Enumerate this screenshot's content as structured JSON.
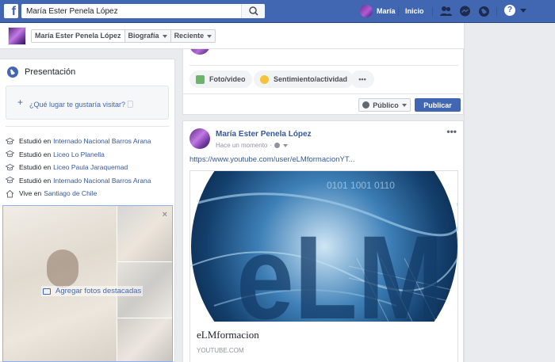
{
  "topbar": {
    "logo": "f",
    "search_value": "María Ester Penela López",
    "user_name": "María",
    "home_label": "Inicio",
    "help_label": "?"
  },
  "timeline_header": {
    "tabs": [
      {
        "label": "María Ester Penela López"
      },
      {
        "label": "Biografía"
      },
      {
        "label": "Reciente"
      }
    ]
  },
  "intro": {
    "title": "Presentación",
    "visit_prompt": "¿Qué lugar te gustaría visitar? 🗌",
    "items": [
      {
        "prefix": "Estudió en",
        "link": "Internado Nacional Barros Arana",
        "icon": "graduation-cap-icon"
      },
      {
        "prefix": "Estudió en",
        "link": "Liceo Lo Planella",
        "icon": "graduation-cap-icon"
      },
      {
        "prefix": "Estudió en",
        "link": "Liceo Paula Jaraquemad",
        "icon": "graduation-cap-icon"
      },
      {
        "prefix": "Estudió en",
        "link": "Internado Nacional Barros Arana",
        "icon": "graduation-cap-icon"
      },
      {
        "prefix": "Vive en",
        "link": "Santiago de Chile",
        "icon": "home-icon"
      }
    ],
    "featured_label": "Agregar fotos destacadas",
    "featured_close": "×"
  },
  "composer": {
    "actions": [
      {
        "label": "Foto/video",
        "icon": "photo-icon"
      },
      {
        "label": "Sentimiento/actividad",
        "icon": "smiley-icon"
      },
      {
        "label": "•••",
        "icon": "more-icon"
      }
    ],
    "privacy_label": "Público",
    "publish_label": "Publicar"
  },
  "post": {
    "author": "María Ester Penela López",
    "time": "Hace un momento",
    "menu": "•••",
    "link_text": "https://www.youtube.com/user/eLMformacionYT...",
    "preview": {
      "logo_text": "eLM",
      "title": "eLMformacion",
      "domain": "YOUTUBE.COM"
    }
  },
  "colors": {
    "brand": "#4267b2",
    "link": "#365899",
    "page_bg": "#e9ebee"
  }
}
